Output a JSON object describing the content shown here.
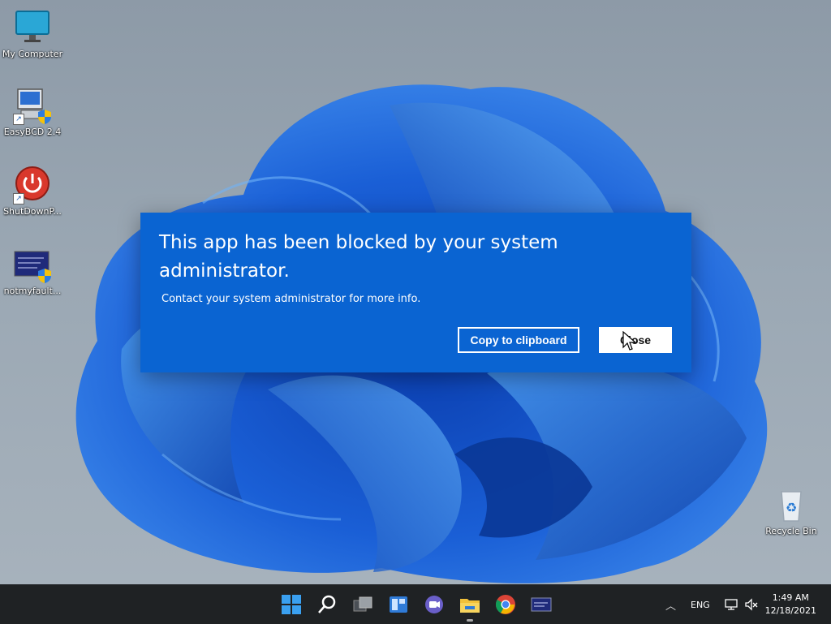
{
  "desktop": {
    "icons": [
      {
        "label": "My Computer"
      },
      {
        "label": "EasyBCD 2.4"
      },
      {
        "label": "ShutDownP..."
      },
      {
        "label": "notmyfault..."
      },
      {
        "label": "Recycle Bin"
      }
    ]
  },
  "dialog": {
    "title": "This app has been blocked by your system administrator.",
    "message": "Contact your system administrator for more info.",
    "copy_label": "Copy to clipboard",
    "close_label": "Close"
  },
  "taskbar": {
    "apps": [
      "start",
      "search",
      "task-view",
      "widgets",
      "teams-chat",
      "file-explorer",
      "chrome",
      "app-window"
    ],
    "language": "ENG",
    "time": "1:49 AM",
    "date": "12/18/2021"
  },
  "colors": {
    "dialog_bg": "#0a64d2",
    "taskbar_bg": "#1f2224"
  }
}
